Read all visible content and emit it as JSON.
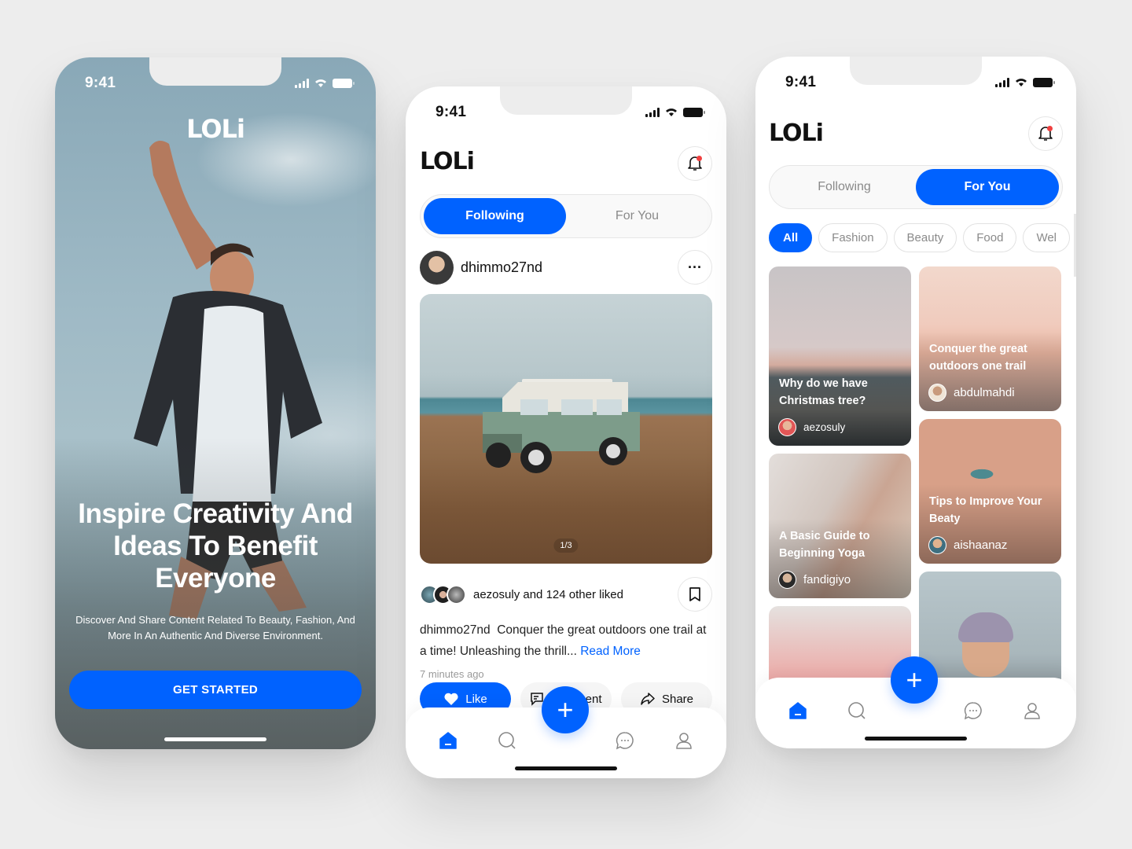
{
  "status_bar": {
    "time": "9:41"
  },
  "brand": {
    "logo_text": "LOLi",
    "primary_color": "#0062ff",
    "notification_dot_color": "#f04040"
  },
  "onboarding": {
    "headline": "Inspire Creativity And Ideas To Benefit Everyone",
    "subtitle": "Discover And Share Content Related To Beauty, Fashion, And More In An Authentic And Diverse Environment.",
    "cta_label": "GET STARTED"
  },
  "feed": {
    "tabs": [
      {
        "label": "Following",
        "active": true
      },
      {
        "label": "For You",
        "active": false
      }
    ],
    "post": {
      "username": "dhimmo27nd",
      "image_indicator": "1/3",
      "liked_by_user": "aezosuly",
      "liked_by_suffix": "and 124 other liked",
      "caption_user": "dhimmo27nd",
      "caption_text": "Conquer the great outdoors one trail at a time! Unleashing the thrill...",
      "read_more": "Read More",
      "time_ago": "7 minutes ago",
      "actions": {
        "like": "Like",
        "comment": "Comment",
        "share": "Share"
      }
    }
  },
  "explore": {
    "tabs": [
      {
        "label": "Following",
        "active": false
      },
      {
        "label": "For You",
        "active": true
      }
    ],
    "chips": [
      {
        "label": "All",
        "active": true
      },
      {
        "label": "Fashion",
        "active": false
      },
      {
        "label": "Beauty",
        "active": false
      },
      {
        "label": "Food",
        "active": false
      },
      {
        "label": "Wel",
        "active": false
      }
    ],
    "cards": [
      {
        "title": "Why do we have Christmas tree?",
        "user": "aezosuly"
      },
      {
        "title": "Conquer the great outdoors one trail",
        "user": "abdulmahdi"
      },
      {
        "title": "Tips to Improve Your Beaty",
        "user": "aishaanaz"
      },
      {
        "title": "A Basic Guide to Beginning Yoga",
        "user": "fandigiyo"
      }
    ]
  },
  "nav": {
    "items": [
      {
        "icon": "home-icon",
        "active": true
      },
      {
        "icon": "search-icon",
        "active": false
      },
      {
        "icon": "add-icon",
        "active": false
      },
      {
        "icon": "chat-icon",
        "active": false
      },
      {
        "icon": "profile-icon",
        "active": false
      }
    ]
  }
}
